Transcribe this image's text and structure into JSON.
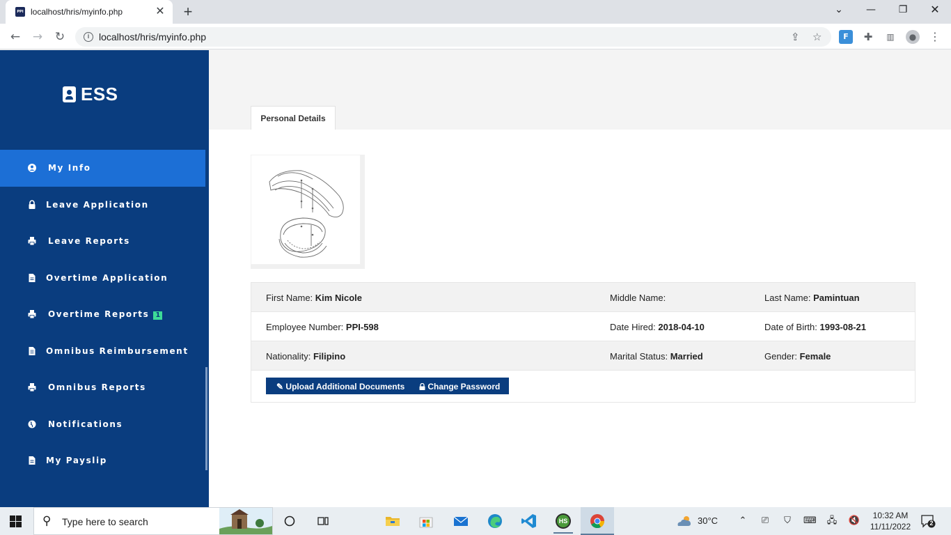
{
  "browser": {
    "tab_title": "localhost/hris/myinfo.php",
    "tab_favicon_text": "PPI",
    "url": "localhost/hris/myinfo.php"
  },
  "sidebar": {
    "brand": "ESS",
    "items": [
      {
        "label": "My Info",
        "icon": "user-circle-icon",
        "active": true
      },
      {
        "label": "Leave Application",
        "icon": "lock-icon"
      },
      {
        "label": "Leave Reports",
        "icon": "printer-icon"
      },
      {
        "label": "Overtime Application",
        "icon": "file-icon"
      },
      {
        "label": "Overtime Reports",
        "icon": "printer-icon",
        "badge": "1"
      },
      {
        "label": "Omnibus Reimbursement",
        "icon": "file-alt-icon"
      },
      {
        "label": "Omnibus Reports",
        "icon": "printer-icon"
      },
      {
        "label": "Notifications",
        "icon": "globe-icon"
      },
      {
        "label": "My Payslip",
        "icon": "file-icon"
      }
    ]
  },
  "main": {
    "tab": "Personal Details",
    "details": {
      "first_name_label": "First Name:",
      "first_name": "Kim Nicole",
      "middle_name_label": "Middle Name:",
      "middle_name": "",
      "last_name_label": "Last Name:",
      "last_name": "Pamintuan",
      "employee_number_label": "Employee Number:",
      "employee_number": "PPI-598",
      "date_hired_label": "Date Hired:",
      "date_hired": "2018-04-10",
      "dob_label": "Date of Birth:",
      "dob": "1993-08-21",
      "nationality_label": "Nationality:",
      "nationality": "Filipino",
      "marital_status_label": "Marital Status:",
      "marital_status": "Married",
      "gender_label": "Gender:",
      "gender": "Female"
    },
    "buttons": {
      "upload": "Upload Additional Documents",
      "change_password": "Change Password"
    }
  },
  "taskbar": {
    "search_placeholder": "Type here to search",
    "weather": "30°C",
    "time": "10:32 AM",
    "date": "11/11/2022",
    "notifications": "2",
    "hs_label": "HS"
  },
  "colors": {
    "sidebar": "#0a3d7f",
    "active": "#1c6fd6",
    "badge": "#3ddc97"
  }
}
